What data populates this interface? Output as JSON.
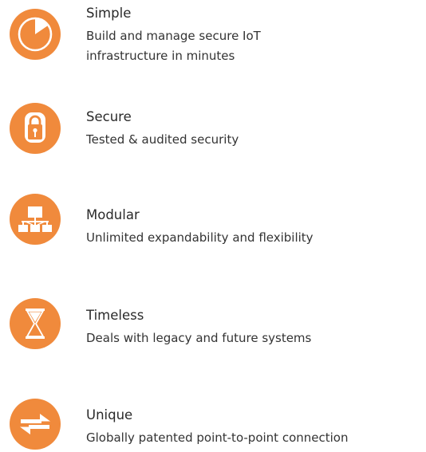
{
  "accent_color": "#f08a3c",
  "features": [
    {
      "icon": "stopwatch-icon",
      "title": "Simple",
      "lines": [
        "Build and manage secure IoT",
        "infrastructure in minutes"
      ]
    },
    {
      "icon": "padlock-icon",
      "title": "Secure",
      "lines": [
        "Tested & audited security"
      ]
    },
    {
      "icon": "network-hierarchy-icon",
      "title": "Modular",
      "lines": [
        "Unlimited expandability and flexibility"
      ]
    },
    {
      "icon": "hourglass-icon",
      "title": "Timeless",
      "lines": [
        "Deals with legacy and future systems"
      ]
    },
    {
      "icon": "bidirectional-arrows-icon",
      "title": "Unique",
      "lines": [
        "Globally patented point-to-point connection"
      ]
    }
  ]
}
